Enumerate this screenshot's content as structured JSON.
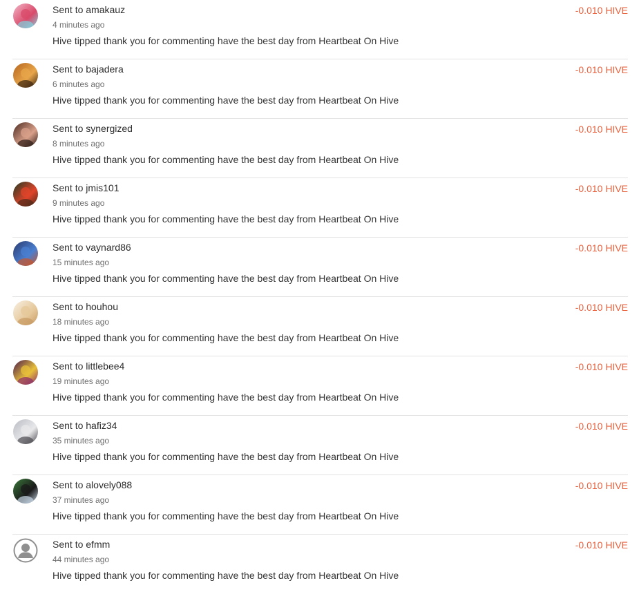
{
  "transfers": [
    {
      "prefix": "Sent to",
      "user": "amakauz",
      "time": "4 minutes ago",
      "memo": "Hive tipped thank you for commenting have the best day from Heartbeat On Hive",
      "amount": "-0.010 HIVE",
      "avatar": "photo-avatar",
      "colors": [
        "#f2b6c8",
        "#d94a6a",
        "#7fd3e0"
      ]
    },
    {
      "prefix": "Sent to",
      "user": "bajadera",
      "time": "6 minutes ago",
      "memo": "Hive tipped thank you for commenting have the best day from Heartbeat On Hive",
      "amount": "-0.010 HIVE",
      "avatar": "photo-avatar",
      "colors": [
        "#b5651d",
        "#e8a64a",
        "#3a2410"
      ]
    },
    {
      "prefix": "Sent to",
      "user": "synergized",
      "time": "8 minutes ago",
      "memo": "Hive tipped thank you for commenting have the best day from Heartbeat On Hive",
      "amount": "-0.010 HIVE",
      "avatar": "photo-avatar",
      "colors": [
        "#4a2a20",
        "#d9a08a",
        "#2a1a14"
      ]
    },
    {
      "prefix": "Sent to",
      "user": "jmis101",
      "time": "9 minutes ago",
      "memo": "Hive tipped thank you for commenting have the best day from Heartbeat On Hive",
      "amount": "-0.010 HIVE",
      "avatar": "photo-avatar",
      "colors": [
        "#1f3a22",
        "#e0442a",
        "#4a2a1a"
      ]
    },
    {
      "prefix": "Sent to",
      "user": "vaynard86",
      "time": "15 minutes ago",
      "memo": "Hive tipped thank you for commenting have the best day from Heartbeat On Hive",
      "amount": "-0.010 HIVE",
      "avatar": "photo-avatar",
      "colors": [
        "#2b3a6e",
        "#4a7fd0",
        "#c7542a"
      ]
    },
    {
      "prefix": "Sent to",
      "user": "houhou",
      "time": "18 minutes ago",
      "memo": "Hive tipped thank you for commenting have the best day from Heartbeat On Hive",
      "amount": "-0.010 HIVE",
      "avatar": "photo-avatar",
      "colors": [
        "#f7efe2",
        "#e6c89a",
        "#c79a63"
      ]
    },
    {
      "prefix": "Sent to",
      "user": "littlebee4",
      "time": "19 minutes ago",
      "memo": "Hive tipped thank you for commenting have the best day from Heartbeat On Hive",
      "amount": "-0.010 HIVE",
      "avatar": "photo-avatar",
      "colors": [
        "#4a1a4a",
        "#e8c03a",
        "#8a2a6a"
      ]
    },
    {
      "prefix": "Sent to",
      "user": "hafiz34",
      "time": "35 minutes ago",
      "memo": "Hive tipped thank you for commenting have the best day from Heartbeat On Hive",
      "amount": "-0.010 HIVE",
      "avatar": "photo-avatar",
      "colors": [
        "#b8bcc4",
        "#e8e8ea",
        "#4a4a50"
      ]
    },
    {
      "prefix": "Sent to",
      "user": "alovely088",
      "time": "37 minutes ago",
      "memo": "Hive tipped thank you for commenting have the best day from Heartbeat On Hive",
      "amount": "-0.010 HIVE",
      "avatar": "photo-avatar",
      "colors": [
        "#3a7a3a",
        "#1a1a1a",
        "#c9d9e8"
      ]
    },
    {
      "prefix": "Sent to",
      "user": "efmm",
      "time": "44 minutes ago",
      "memo": "Hive tipped thank you for commenting have the best day from Heartbeat On Hive",
      "amount": "-0.010 HIVE",
      "avatar": "default-user-icon",
      "colors": [
        "#ffffff",
        "#8f8f8f",
        "#8f8f8f"
      ]
    }
  ]
}
